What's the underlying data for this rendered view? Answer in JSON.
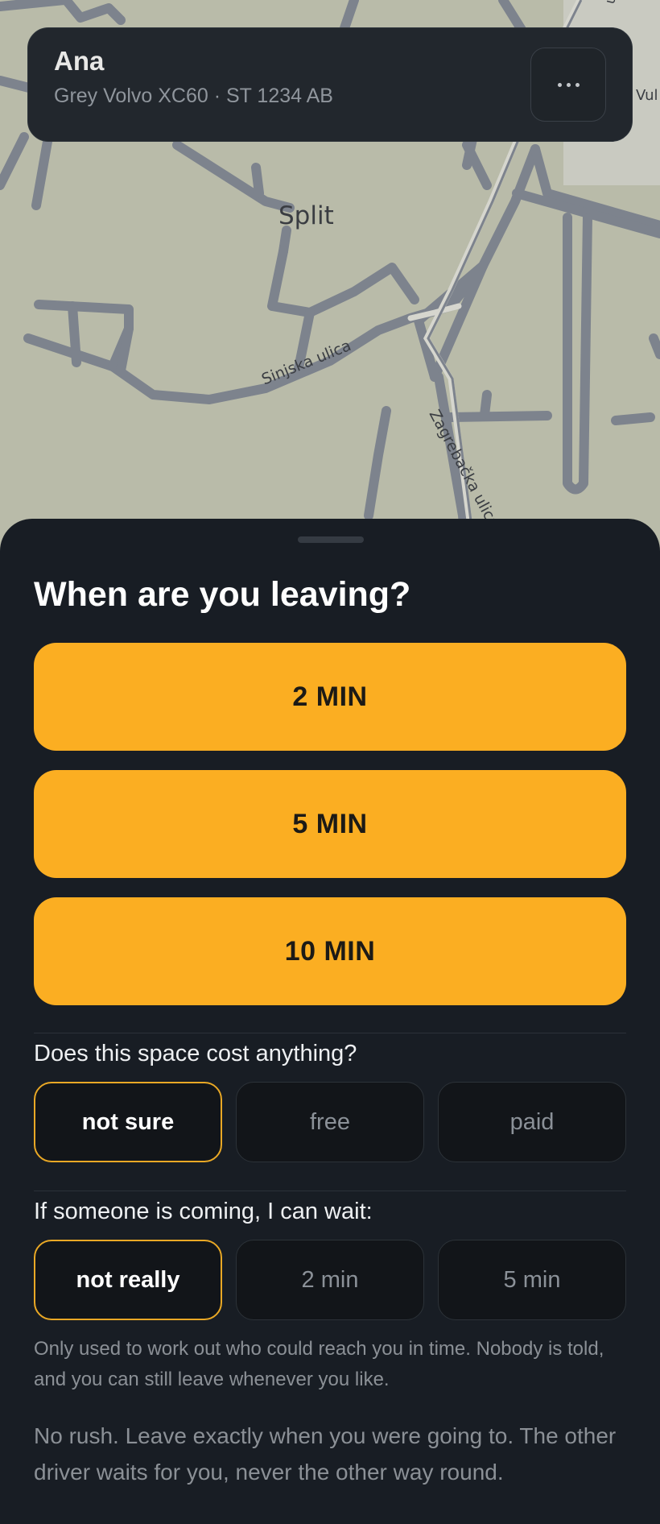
{
  "map": {
    "city_label": "Split",
    "street_1": "Sinjska ulica",
    "street_2": "Zagrebačka ulica",
    "edge_label_right": "Vul",
    "edge_label_top": "uli"
  },
  "driver": {
    "name": "Ana",
    "car": "Grey Volvo XC60 · ST 1234 AB",
    "more_icon": "ellipsis-icon"
  },
  "sheet": {
    "title": "When are you leaving?",
    "leave_options": [
      "2 MIN",
      "5 MIN",
      "10 MIN"
    ],
    "cost": {
      "question": "Does this space cost anything?",
      "options": [
        "not sure",
        "free",
        "paid"
      ],
      "selected": "not sure"
    },
    "wait": {
      "question": "If someone is coming, I can wait:",
      "options": [
        "not really",
        "2 min",
        "5 min"
      ],
      "selected": "not really"
    },
    "note": "Only used to work out who could reach you in time. Nobody is told, and you can still leave whenever you like.",
    "reassurance": "No rush. Leave exactly when you were going to. The other driver waits for you, never the other way round."
  },
  "colors": {
    "accent": "#fbae22",
    "sheet_bg": "#181d24",
    "map_bg": "#b9bba9",
    "road": "#7d838d"
  }
}
